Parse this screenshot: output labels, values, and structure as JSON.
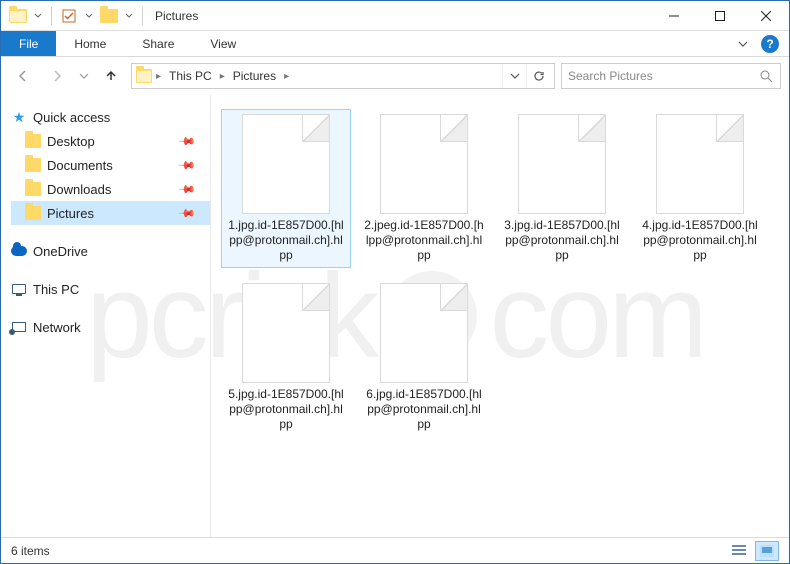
{
  "titlebar": {
    "title": "Pictures"
  },
  "ribbon": {
    "file": "File",
    "tabs": [
      "Home",
      "Share",
      "View"
    ]
  },
  "breadcrumb": {
    "segments": [
      "This PC",
      "Pictures"
    ]
  },
  "search": {
    "placeholder": "Search Pictures"
  },
  "nav": {
    "quick_access": {
      "label": "Quick access"
    },
    "pinned": [
      {
        "label": "Desktop",
        "icon": "folder"
      },
      {
        "label": "Documents",
        "icon": "folder"
      },
      {
        "label": "Downloads",
        "icon": "folder"
      },
      {
        "label": "Pictures",
        "icon": "folder",
        "selected": true
      }
    ],
    "onedrive": {
      "label": "OneDrive"
    },
    "this_pc": {
      "label": "This PC"
    },
    "network": {
      "label": "Network"
    }
  },
  "files": [
    {
      "name": "1.jpg.id-1E857D00.[hlpp@protonmail.ch].hlpp",
      "selected": true
    },
    {
      "name": "2.jpeg.id-1E857D00.[hlpp@protonmail.ch].hlpp"
    },
    {
      "name": "3.jpg.id-1E857D00.[hlpp@protonmail.ch].hlpp"
    },
    {
      "name": "4.jpg.id-1E857D00.[hlpp@protonmail.ch].hlpp"
    },
    {
      "name": "5.jpg.id-1E857D00.[hlpp@protonmail.ch].hlpp"
    },
    {
      "name": "6.jpg.id-1E857D00.[hlpp@protonmail.ch].hlpp"
    }
  ],
  "status": {
    "count_label": "6 items"
  },
  "watermark": "pcrisk.com"
}
